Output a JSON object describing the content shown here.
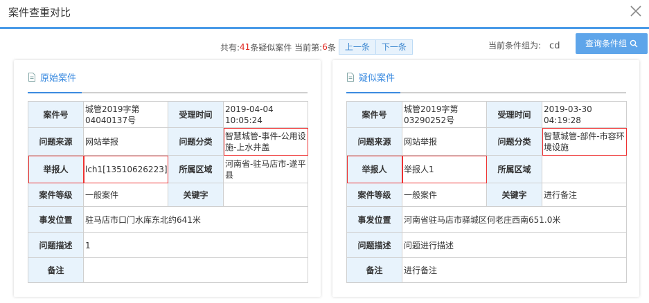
{
  "window": {
    "title": "案件查重对比"
  },
  "nav": {
    "total_prefix": "共有: ",
    "total_count": "41",
    "total_suffix": "条疑似案件 当前第: ",
    "current": "6",
    "current_suffix": "条",
    "prev_label": "上一条",
    "next_label": "下一条"
  },
  "condition": {
    "label": "当前条件组为:",
    "value": "cd",
    "query_button": "查询条件组"
  },
  "labels": {
    "case_no": "案件号",
    "time": "受理时间",
    "source": "问题来源",
    "category": "问题分类",
    "reporter": "举报人",
    "region": "所属区域",
    "level": "案件等级",
    "keyword": "关键字",
    "location": "事发位置",
    "description": "问题描述",
    "remark": "备注"
  },
  "original": {
    "heading": "原始案件",
    "case_no": "城管2019字第04040137号",
    "time": "2019-04-04 10:05:24",
    "source": "网站举报",
    "category": "智慧城管-事件-公用设施-上水井盖",
    "reporter": "lch1[13510626223]",
    "region": "河南省-驻马店市-遂平县",
    "level": "一般案件",
    "keyword": "",
    "location": "驻马店市口门水库东北约641米",
    "description": "1",
    "remark": ""
  },
  "similar": {
    "heading": "疑似案件",
    "case_no": "城管2019字第03290252号",
    "time": "2019-03-30 04:19:28",
    "source": "网站举报",
    "category": "智慧城管-部件-市容环境设施",
    "reporter": "举报人1",
    "region": "",
    "level": "一般案件",
    "keyword": "进行备注",
    "location": "河南省驻马店市驿城区何老庄西南651.0米",
    "description": "问题进行描述",
    "remark": "进行备注"
  },
  "colors": {
    "accent": "#3b8be0",
    "label_bg": "#e8f3fc",
    "highlight": "#e33333",
    "count": "#e0261e"
  }
}
